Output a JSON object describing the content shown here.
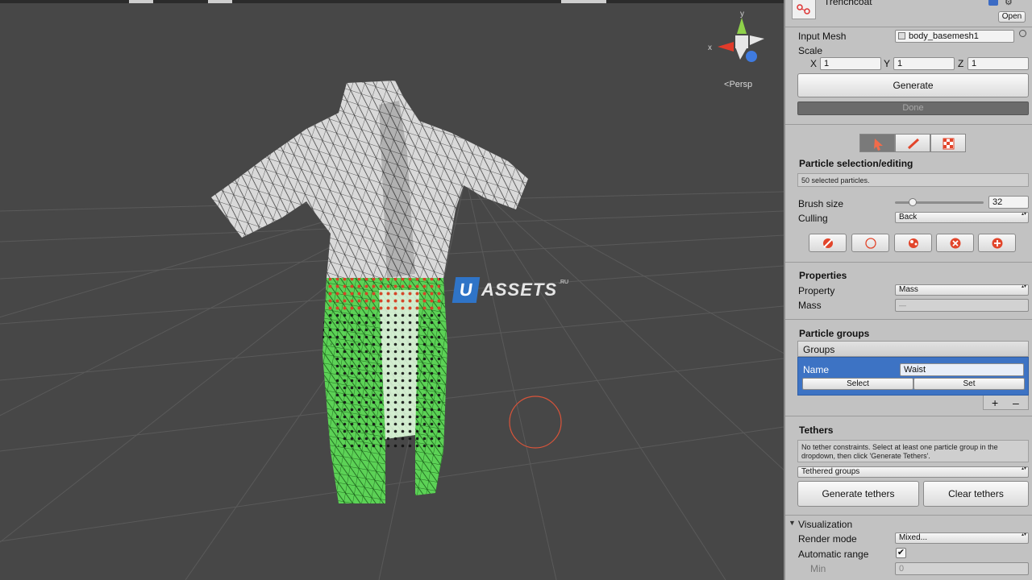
{
  "scene": {
    "persp_label": "Persp",
    "watermark": {
      "letter": "U",
      "text": "ASSETS",
      "suffix": ".RU"
    },
    "gizmo": {
      "x_label": "x",
      "y_label": "y"
    }
  },
  "inspector": {
    "object_title": "Trenchcoat",
    "open_button": "Open",
    "input_mesh_label": "Input Mesh",
    "input_mesh_value": "body_basemesh1",
    "scale_label": "Scale",
    "scale": {
      "x_label": "X",
      "x": "1",
      "y_label": "Y",
      "y": "1",
      "z_label": "Z",
      "z": "1"
    },
    "generate_button": "Generate",
    "progress_label": "Done",
    "progress_value": 1,
    "selection": {
      "header": "Particle selection/editing",
      "status": "50 selected particles.",
      "brush_size_label": "Brush size",
      "brush_size_value": "32",
      "brush_slider_fraction": 0.15,
      "culling_label": "Culling",
      "culling_value": "Back"
    },
    "properties": {
      "header": "Properties",
      "property_label": "Property",
      "property_value": "Mass",
      "mass_label": "Mass",
      "mass_value": "—"
    },
    "groups": {
      "header": "Particle groups",
      "list_title": "Groups",
      "name_label": "Name",
      "name_value": "Waist",
      "select_button": "Select",
      "set_button": "Set",
      "add_symbol": "+",
      "remove_symbol": "–"
    },
    "tethers": {
      "header": "Tethers",
      "info": "No tether constraints. Select at least one particle group in the dropdown, then click 'Generate Tethers'.",
      "tethered_groups": "Tethered groups",
      "generate_button": "Generate tethers",
      "clear_button": "Clear tethers"
    },
    "visualization": {
      "header": "Visualization",
      "render_mode_label": "Render mode",
      "render_mode_value": "Mixed...",
      "automatic_range_label": "Automatic range",
      "automatic_range_checked": true,
      "min_label": "Min",
      "min_value": "0"
    }
  },
  "colors": {
    "scene_bg": "#474747",
    "inspector_bg": "#c2c2c2",
    "selection_blue": "#3d73c4",
    "particle_green": "#3ed23a",
    "particle_red": "#e84a2a",
    "brush_ring": "#d9543a",
    "tool_active": "#f26b4a"
  }
}
